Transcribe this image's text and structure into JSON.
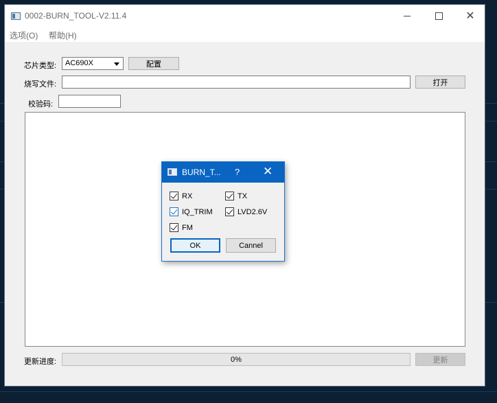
{
  "window": {
    "title": "0002-BURN_TOOL-V2.11.4",
    "minimize_icon": "minimize-icon",
    "maximize_icon": "maximize-icon",
    "close_icon": "close-icon",
    "close_glyph": "✕"
  },
  "menu": {
    "items": [
      {
        "label": "选项(O)"
      },
      {
        "label": "帮助(H)"
      }
    ]
  },
  "form": {
    "chip_type_label": "芯片类型:",
    "chip_type_value": "AC690X",
    "config_button": "配置",
    "burn_file_label": "烧写文件:",
    "burn_file_value": "",
    "open_button": "打开",
    "checksum_label": "校验码:",
    "checksum_value": ""
  },
  "footer": {
    "progress_label": "更新进度:",
    "progress_value": 0,
    "progress_text": "0%",
    "update_button": "更新"
  },
  "dialog": {
    "title": "BURN_T...",
    "help_glyph": "?",
    "close_glyph": "✕",
    "options": [
      {
        "label": "RX",
        "checked": true
      },
      {
        "label": "TX",
        "checked": true
      },
      {
        "label": "IQ_TRIM",
        "checked": true
      },
      {
        "label": "LVD2.6V",
        "checked": true
      },
      {
        "label": "FM",
        "checked": true
      }
    ],
    "ok_label": "OK",
    "cancel_label": "Cannel"
  },
  "colors": {
    "dialog_titlebar": "#0a64c2",
    "window_bg": "#f0f0f0",
    "progress_fill": "#06b025"
  }
}
